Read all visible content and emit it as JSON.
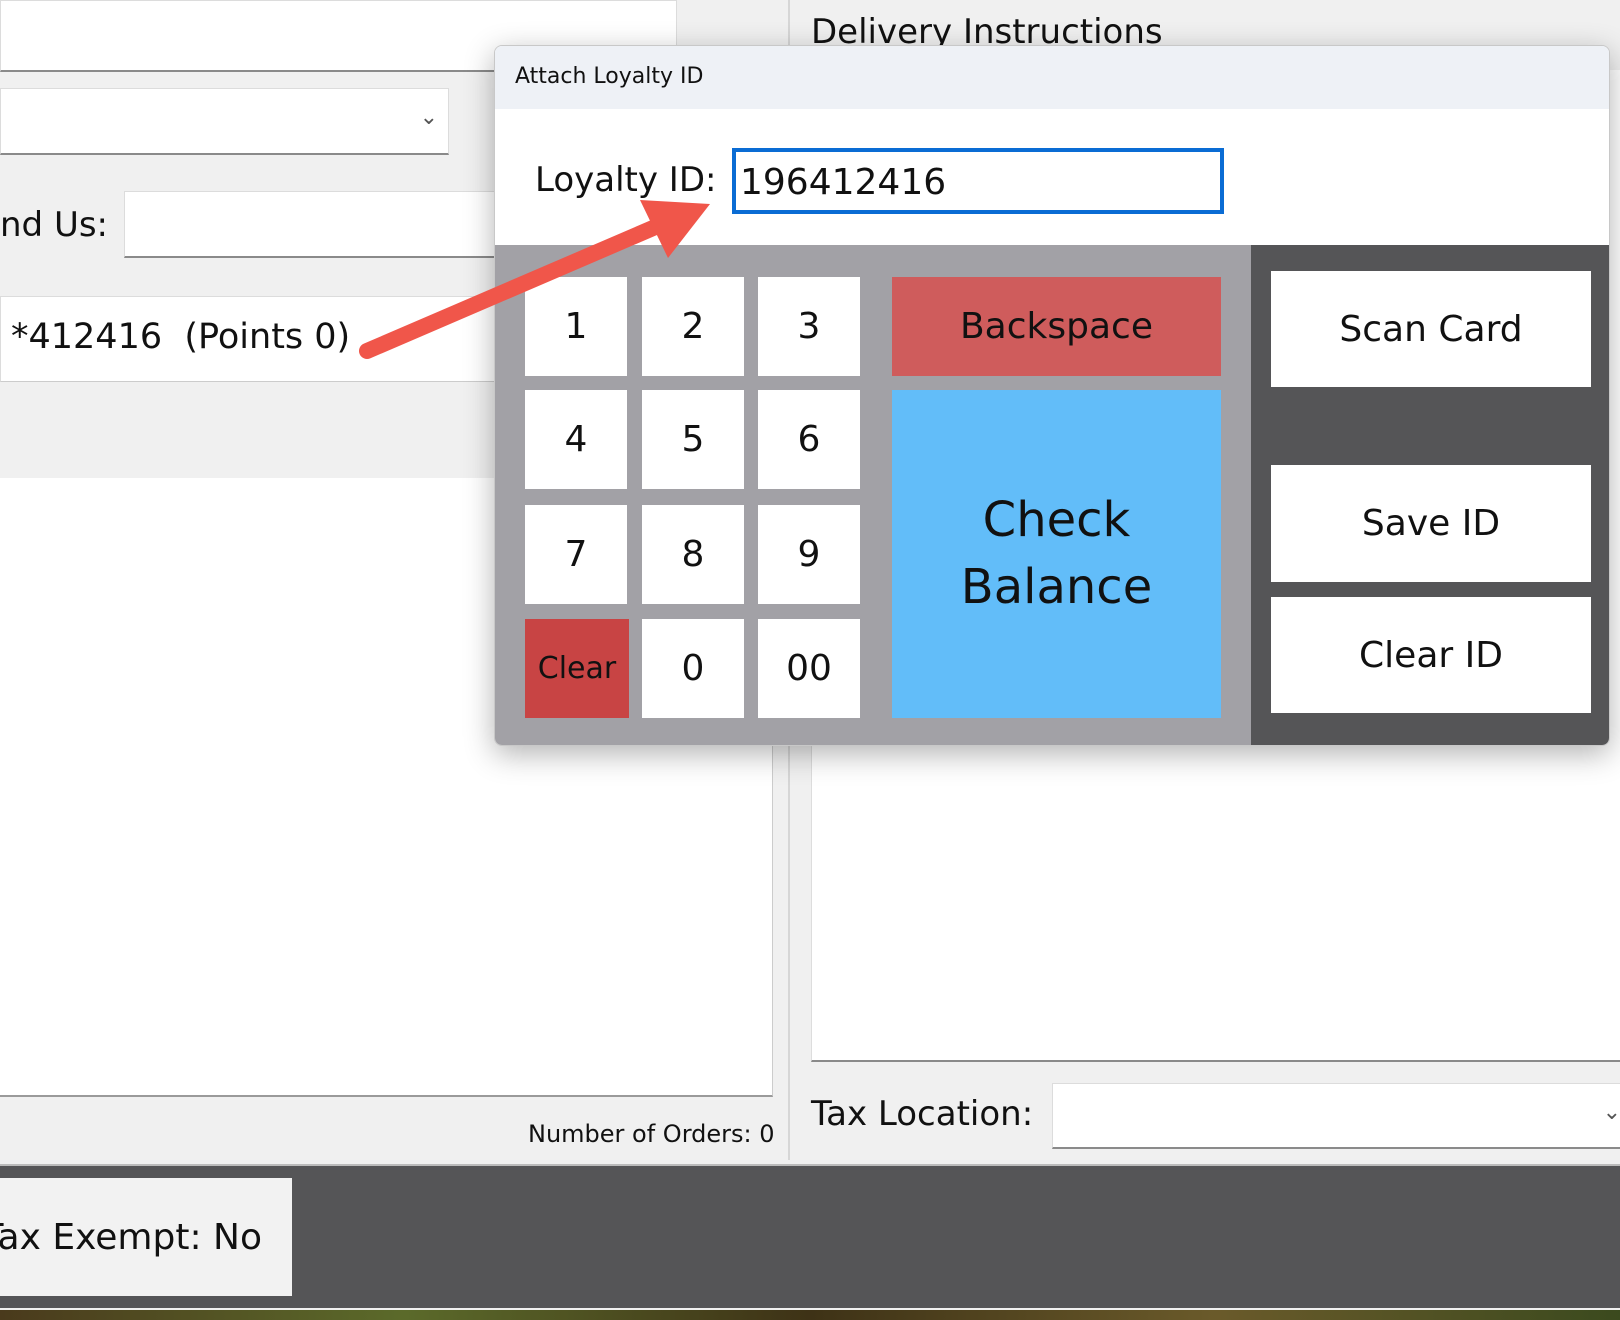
{
  "background": {
    "find_us_label": "nd Us:",
    "loyalty_display": "*412416  (Points 0)",
    "delivery_instructions_label": "Delivery Instructions",
    "number_of_orders": "Number of Orders: 0",
    "tax_location_label": "Tax Location:",
    "tax_exempt_button": "Tax Exempt: No"
  },
  "dialog": {
    "title": "Attach Loyalty ID",
    "loyalty_label": "Loyalty ID:",
    "loyalty_value": "196412416",
    "keys": [
      "1",
      "2",
      "3",
      "4",
      "5",
      "6",
      "7",
      "8",
      "9",
      "Clear",
      "0",
      "00"
    ],
    "backspace": "Backspace",
    "check_balance": "Check Balance",
    "scan_card": "Scan Card",
    "save_id": "Save ID",
    "clear_id": "Clear ID"
  },
  "colors": {
    "keypad_bg": "#a2a1a6",
    "side_panel_bg": "#555557",
    "backspace": "#cf5c5c",
    "clear": "#c84444",
    "check_balance": "#62bdf9",
    "focus_border": "#0a6cd4",
    "annotation_arrow": "#f0564a"
  }
}
